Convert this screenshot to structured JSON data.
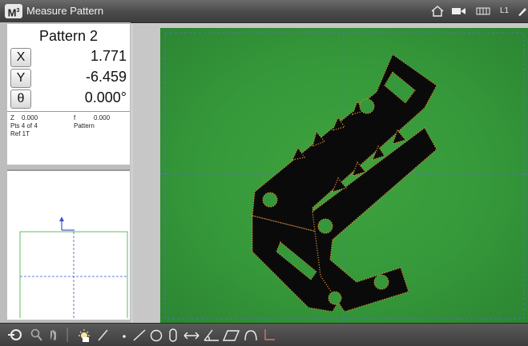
{
  "titlebar": {
    "logo": "M",
    "title": "Measure Pattern",
    "icons": [
      "home-icon",
      "video-icon",
      "grid-icon",
      "edit-icon"
    ],
    "layer_label": "L1"
  },
  "dro": {
    "title": "Pattern 2",
    "axes": [
      {
        "label": "X",
        "value": "1.771"
      },
      {
        "label": "Y",
        "value": "-6.459"
      },
      {
        "label": "θ",
        "value": "0.000°"
      }
    ],
    "z_label": "Z",
    "z_value": "0.000",
    "f_label": "f",
    "f_value": "0.000",
    "points": "Pts 4 of 4",
    "feature_type": "Pattern",
    "reference": "Ref 1T"
  },
  "toolbar": {
    "tools": [
      "probe-icon",
      "magnifier-icon",
      "hand-icon",
      "divider-icon",
      "light-icon",
      "brush-icon",
      "point-icon",
      "line-icon",
      "circle-icon",
      "slot-icon",
      "distance-icon",
      "angle-icon",
      "parallelogram-icon",
      "arc-icon",
      "skew-icon"
    ]
  },
  "colors": {
    "camera_green": "#35983a",
    "part_black": "#0a0a0a",
    "edge_orange": "#d98a3a",
    "grid_blue": "#5b6fd6"
  }
}
